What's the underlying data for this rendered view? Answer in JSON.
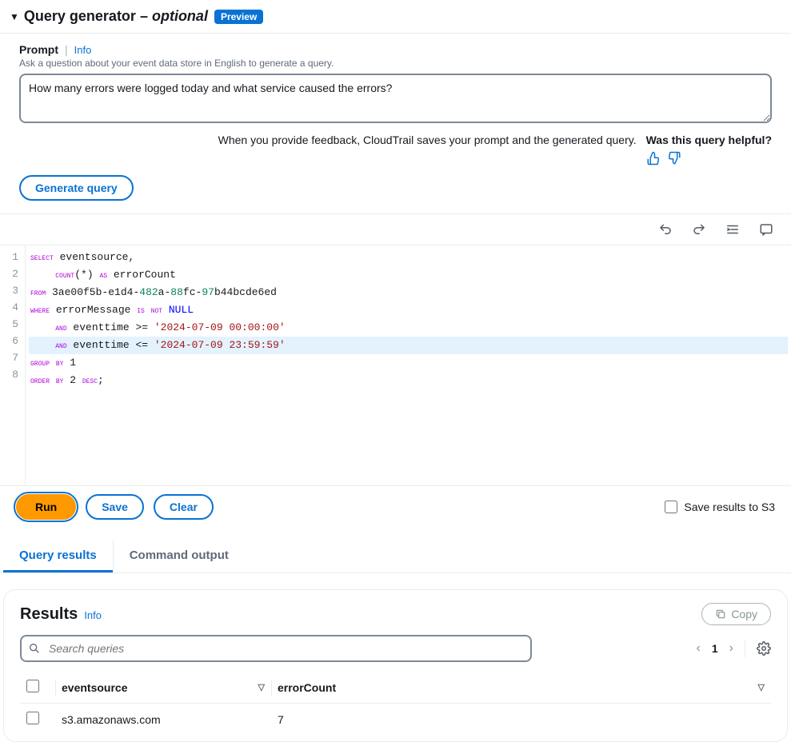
{
  "section": {
    "title_main": "Query generator",
    "title_sep": " – ",
    "title_opt": "optional",
    "preview_badge": "Preview"
  },
  "prompt": {
    "label": "Prompt",
    "info": "Info",
    "help": "Ask a question about your event data store in English to generate a query.",
    "value": "How many errors were logged today and what service caused the errors?",
    "feedback_note": "When you provide feedback, CloudTrail saves your prompt and the generated query.",
    "feedback_q": "Was this query helpful?",
    "generate_btn": "Generate query"
  },
  "editor": {
    "lines": [
      {
        "n": 1,
        "tokens": [
          {
            "t": "SELECT",
            "c": "kw"
          },
          {
            "t": " eventsource,",
            "c": "ident"
          }
        ]
      },
      {
        "n": 2,
        "tokens": [
          {
            "t": "    ",
            "c": "ident"
          },
          {
            "t": "count",
            "c": "kw"
          },
          {
            "t": "(",
            "c": "punc"
          },
          {
            "t": "*",
            "c": "punc"
          },
          {
            "t": ") ",
            "c": "punc"
          },
          {
            "t": "as",
            "c": "kw"
          },
          {
            "t": " errorCount",
            "c": "ident"
          }
        ]
      },
      {
        "n": 3,
        "tokens": [
          {
            "t": "FROM",
            "c": "kw"
          },
          {
            "t": " 3ae00f5b",
            "c": "ident"
          },
          {
            "t": "-",
            "c": "punc"
          },
          {
            "t": "e1d4",
            "c": "ident"
          },
          {
            "t": "-",
            "c": "punc"
          },
          {
            "t": "482",
            "c": "num"
          },
          {
            "t": "a",
            "c": "ident"
          },
          {
            "t": "-",
            "c": "punc"
          },
          {
            "t": "88",
            "c": "num"
          },
          {
            "t": "fc",
            "c": "ident"
          },
          {
            "t": "-",
            "c": "punc"
          },
          {
            "t": "97",
            "c": "num"
          },
          {
            "t": "b44bcde6ed",
            "c": "ident"
          }
        ]
      },
      {
        "n": 4,
        "tokens": [
          {
            "t": "WHERE",
            "c": "kw"
          },
          {
            "t": " errorMessage ",
            "c": "ident"
          },
          {
            "t": "IS",
            "c": "kw"
          },
          {
            "t": " ",
            "c": "ident"
          },
          {
            "t": "NOT",
            "c": "kw"
          },
          {
            "t": " ",
            "c": "ident"
          },
          {
            "t": "NULL",
            "c": "null"
          }
        ]
      },
      {
        "n": 5,
        "tokens": [
          {
            "t": "    ",
            "c": "ident"
          },
          {
            "t": "AND",
            "c": "kw"
          },
          {
            "t": " eventtime >= ",
            "c": "ident"
          },
          {
            "t": "'2024-07-09 00:00:00'",
            "c": "str"
          }
        ]
      },
      {
        "n": 6,
        "hl": true,
        "tokens": [
          {
            "t": "    ",
            "c": "ident"
          },
          {
            "t": "AND",
            "c": "kw"
          },
          {
            "t": " eventtime <= ",
            "c": "ident"
          },
          {
            "t": "'2024-07-09 23:59:59'",
            "c": "str"
          }
        ]
      },
      {
        "n": 7,
        "tokens": [
          {
            "t": "GROUP",
            "c": "kw"
          },
          {
            "t": " ",
            "c": "ident"
          },
          {
            "t": "BY",
            "c": "kw"
          },
          {
            "t": " 1",
            "c": "ident"
          }
        ]
      },
      {
        "n": 8,
        "tokens": [
          {
            "t": "ORDER",
            "c": "kw"
          },
          {
            "t": " ",
            "c": "ident"
          },
          {
            "t": "BY",
            "c": "kw"
          },
          {
            "t": " 2 ",
            "c": "ident"
          },
          {
            "t": "DESC",
            "c": "kw"
          },
          {
            "t": ";",
            "c": "punc"
          }
        ]
      }
    ],
    "run_btn": "Run",
    "save_btn": "Save",
    "clear_btn": "Clear",
    "save_results_label": "Save results to S3"
  },
  "tabs": {
    "query_results": "Query results",
    "command_output": "Command output"
  },
  "results": {
    "title": "Results",
    "info": "Info",
    "copy_btn": "Copy",
    "search_placeholder": "Search queries",
    "page_num": "1",
    "columns": {
      "c1": "eventsource",
      "c2": "errorCount"
    },
    "rows": [
      {
        "c1": "s3.amazonaws.com",
        "c2": "7"
      }
    ]
  }
}
